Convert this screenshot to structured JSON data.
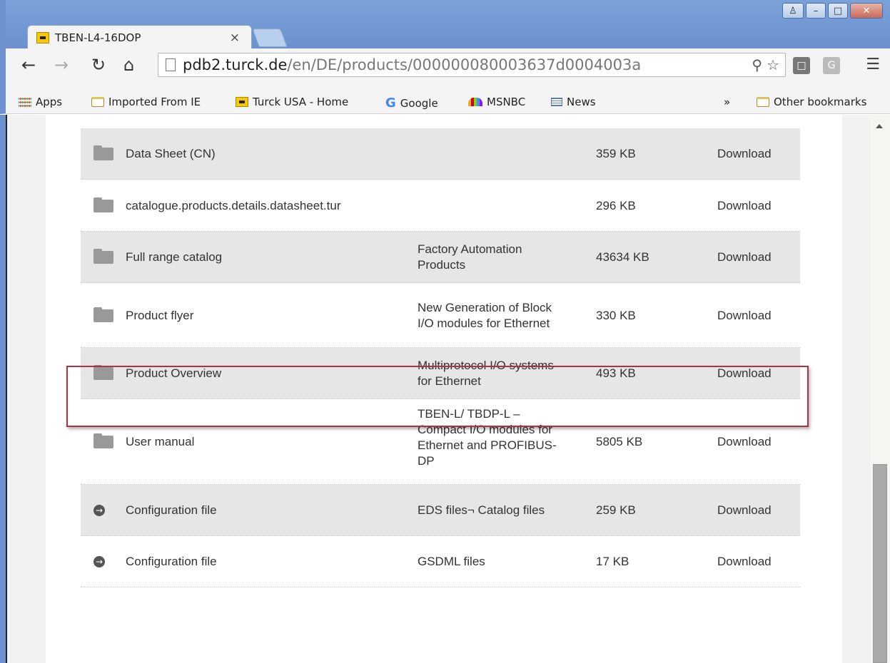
{
  "browser": {
    "tab_title": "TBEN-L4-16DOP",
    "tab_close": "×",
    "url_host": "pdb2.turck.de",
    "url_path": "/en/DE/products/000000080003637d0004003a"
  },
  "bookmarks": [
    {
      "label": "Apps",
      "icon": "apps-icon"
    },
    {
      "label": "Imported From IE",
      "icon": "folder-icon"
    },
    {
      "label": "Turck USA - Home",
      "icon": "turck-icon"
    },
    {
      "label": "Google",
      "icon": "google-icon"
    },
    {
      "label": "MSNBC",
      "icon": "msnbc-icon"
    },
    {
      "label": "News",
      "icon": "news-icon"
    }
  ],
  "bookmarks_overflow": "»",
  "other_bookmarks": "Other bookmarks",
  "rows": [
    {
      "name": "Data Sheet (CN)",
      "desc": "",
      "size": "359 KB",
      "action": "Download",
      "icon": "folder"
    },
    {
      "name": "catalogue.products.details.datasheet.tur",
      "desc": "",
      "size": "296 KB",
      "action": "Download",
      "icon": "folder"
    },
    {
      "name": "Full range catalog",
      "desc": "Factory Automation Products",
      "size": "43634 KB",
      "action": "Download",
      "icon": "folder"
    },
    {
      "name": "Product flyer",
      "desc": "New Generation of Block I/O modules for Ethernet",
      "size": "330 KB",
      "action": "Download",
      "icon": "folder"
    },
    {
      "name": "Product Overview",
      "desc": "Multiprotocol I/O systems for Ethernet",
      "size": "493 KB",
      "action": "Download",
      "icon": "folder"
    },
    {
      "name": "User manual",
      "desc": "TBEN-L/ TBDP-L – Compact I/O modules for Ethernet and PROFIBUS-DP",
      "size": "5805 KB",
      "action": "Download",
      "icon": "folder"
    },
    {
      "name": "Configuration file",
      "desc": "EDS files¬ Catalog files",
      "size": "259 KB",
      "action": "Download",
      "icon": "arrow"
    },
    {
      "name": "Configuration file",
      "desc": "GSDML files",
      "size": "17 KB",
      "action": "Download",
      "icon": "arrow"
    }
  ]
}
